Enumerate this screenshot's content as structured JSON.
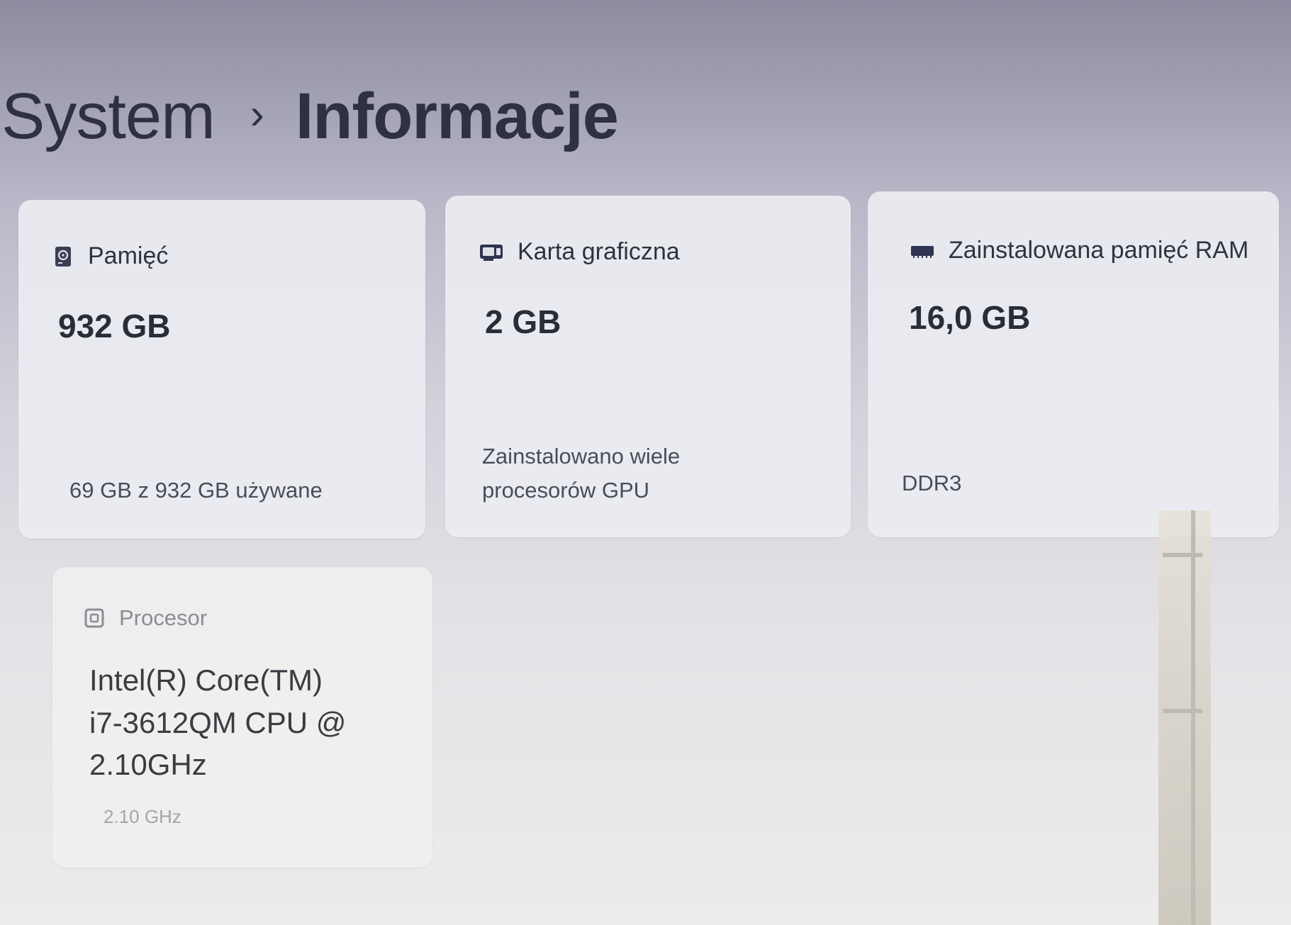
{
  "breadcrumb": {
    "parent": "System",
    "separator": "›",
    "current": "Informacje"
  },
  "cards": {
    "storage": {
      "title": "Pamięć",
      "icon": "storage-drive-icon",
      "value": "932 GB",
      "detail": "69 GB z 932 GB używane"
    },
    "gpu": {
      "title": "Karta graficzna",
      "icon": "graphics-card-icon",
      "value": "2 GB",
      "detail_line1": "Zainstalowano wiele",
      "detail_line2": "procesorów GPU"
    },
    "ram": {
      "title": "Zainstalowana pamięć RAM",
      "icon": "ram-module-icon",
      "value": "16,0 GB",
      "detail": "DDR3"
    },
    "cpu": {
      "title": "Procesor",
      "icon": "processor-chip-icon",
      "value_line1": "Intel(R) Core(TM)",
      "value_line2": "i7-3612QM CPU @",
      "value_line3": "2.10GHz",
      "detail": "2.10 GHz"
    }
  },
  "colors": {
    "text_primary": "#2a2d38",
    "card_background": "#ecedf1",
    "accent_icon": "#3a3f55"
  }
}
